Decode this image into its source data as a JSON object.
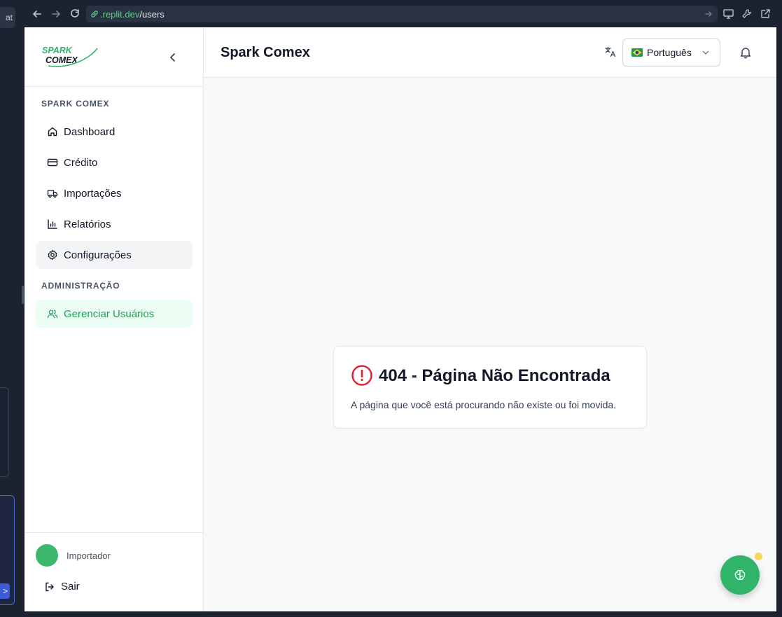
{
  "browser": {
    "url_host": ".replit.dev",
    "url_path": "/users"
  },
  "ide": {
    "chip_label": "at"
  },
  "sidebar": {
    "logo_text": "SPARK COMEX",
    "sections": [
      {
        "label": "SPARK COMEX",
        "items": [
          {
            "label": "Dashboard",
            "icon": "home-icon"
          },
          {
            "label": "Crédito",
            "icon": "credit-card-icon"
          },
          {
            "label": "Importações",
            "icon": "truck-icon"
          },
          {
            "label": "Relatórios",
            "icon": "bar-chart-icon"
          },
          {
            "label": "Configurações",
            "icon": "gear-icon"
          }
        ]
      },
      {
        "label": "ADMINISTRAÇÃO",
        "items": [
          {
            "label": "Gerenciar Usuários",
            "icon": "users-icon",
            "active": true
          }
        ]
      }
    ],
    "user_role": "Importador",
    "logout_label": "Sair"
  },
  "header": {
    "title": "Spark Comex",
    "language": "Português"
  },
  "error_card": {
    "title": "404 - Página Não Encontrada",
    "description": "A página que você está procurando não existe ou foi movida."
  },
  "colors": {
    "brand_green": "#2fb469",
    "active_bg": "#ecfdf3",
    "error_red": "#e0243a"
  }
}
